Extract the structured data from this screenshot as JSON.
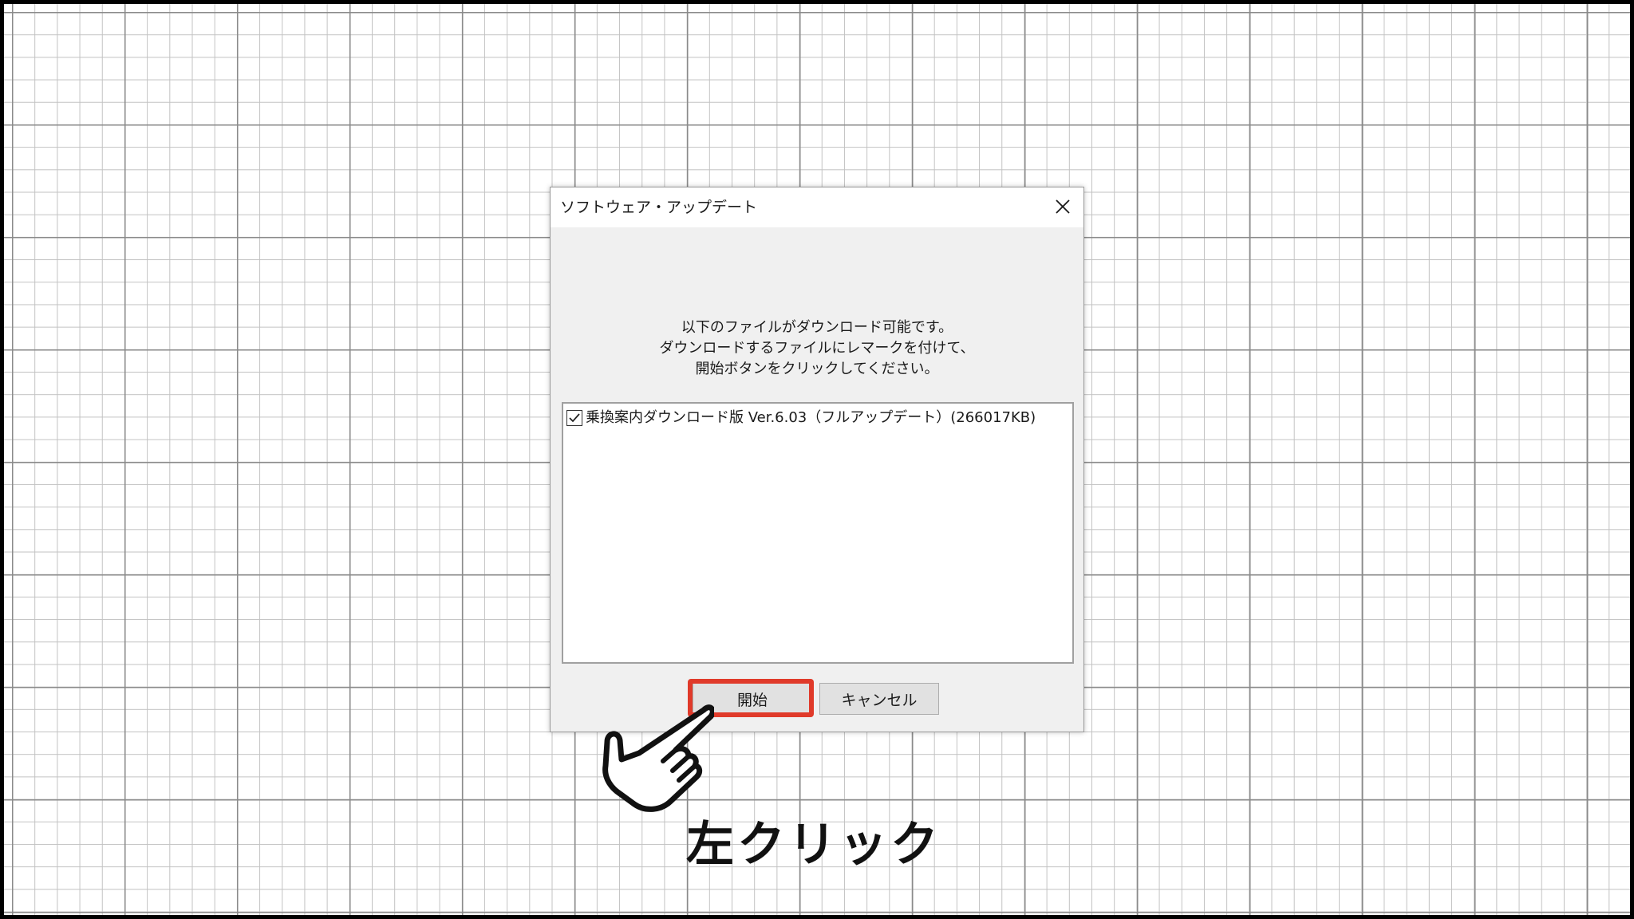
{
  "dialog": {
    "title": "ソフトウェア・アップデート",
    "message_lines": [
      "以下のファイルがダウンロード可能です。",
      "ダウンロードするファイルにレマークを付けて、",
      "開始ボタンをクリックしてください。"
    ],
    "file_list": [
      {
        "label": "乗換案内ダウンロード版 Ver.6.03（フルアップデート）(266017KB)",
        "checked": true
      }
    ],
    "buttons": {
      "start_label": "開始",
      "cancel_label": "キャンセル"
    }
  },
  "annotation": {
    "instruction": "左クリック",
    "highlight_color": "#e03a2a"
  }
}
